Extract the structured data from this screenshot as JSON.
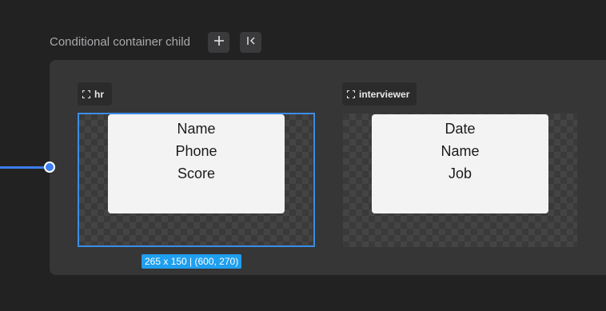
{
  "header": {
    "title": "Conditional container child",
    "add_icon": "plus-icon",
    "collapse_icon": "collapse-left-icon"
  },
  "children": [
    {
      "tag": "hr",
      "tag_icon": "fullscreen-icon",
      "fields": [
        "Name",
        "Phone",
        "Score"
      ],
      "selected": true
    },
    {
      "tag": "interviewer",
      "tag_icon": "fullscreen-icon",
      "fields": [
        "Date",
        "Name",
        "Job"
      ],
      "selected": false
    }
  ],
  "selection_info": "265 x 150 | (600, 270)",
  "colors": {
    "accent": "#3d7ef0",
    "selection": "#3a8ee6",
    "label_bg": "#1f9ff0"
  }
}
